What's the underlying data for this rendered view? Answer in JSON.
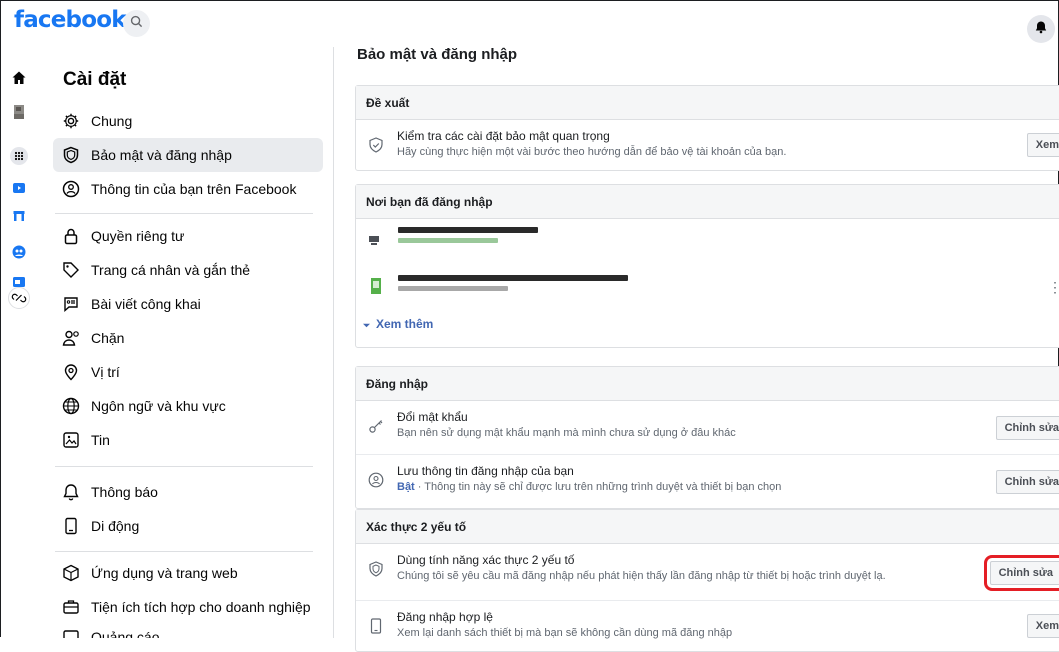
{
  "brand": {
    "logo_text": "facebook",
    "accent": "#1877f2"
  },
  "topbar": {
    "search_icon": "search-icon",
    "bell_icon": "bell-icon"
  },
  "left_rail": [
    "home-icon",
    "avatar",
    "apps-grid-icon",
    "watch-icon",
    "marketplace-icon",
    "groups-icon",
    "gaming-icon",
    "link-icon"
  ],
  "sidebar": {
    "title": "Cài đặt",
    "items": [
      {
        "label": "Chung",
        "icon": "gear-icon"
      },
      {
        "label": "Bảo mật và đăng nhập",
        "icon": "shield-icon",
        "active": true
      },
      {
        "label": "Thông tin của bạn trên Facebook",
        "icon": "info-user-icon"
      },
      {
        "label": "Quyền riêng tư",
        "icon": "lock-icon"
      },
      {
        "label": "Trang cá nhân và gắn thẻ",
        "icon": "tag-icon"
      },
      {
        "label": "Bài viết công khai",
        "icon": "post-icon"
      },
      {
        "label": "Chặn",
        "icon": "block-user-icon"
      },
      {
        "label": "Vị trí",
        "icon": "location-icon"
      },
      {
        "label": "Ngôn ngữ và khu vực",
        "icon": "globe-icon"
      },
      {
        "label": "Tin",
        "icon": "story-icon"
      },
      {
        "label": "Thông báo",
        "icon": "bell-icon"
      },
      {
        "label": "Di động",
        "icon": "mobile-icon"
      },
      {
        "label": "Ứng dụng và trang web",
        "icon": "apps-icon"
      },
      {
        "label": "Tiện ích tích hợp cho doanh nghiệp",
        "icon": "business-icon"
      },
      {
        "label": "Quảng cáo",
        "icon": "ads-icon"
      }
    ]
  },
  "main": {
    "title": "Bảo mật và đăng nhập",
    "recommended": {
      "header": "Đề xuất",
      "row": {
        "title": "Kiểm tra các cài đặt bảo mật quan trọng",
        "subtitle": "Hãy cùng thực hiện một vài bước theo hướng dẫn để bảo vệ tài khoản của bạn.",
        "button": "Xem"
      }
    },
    "where_logged_in": {
      "header": "Nơi bạn đã đăng nhập",
      "more_link": "Xem thêm",
      "menu_glyph": "⋮"
    },
    "login": {
      "header": "Đăng nhập",
      "rows": [
        {
          "title": "Đổi mật khẩu",
          "subtitle": "Bạn nên sử dụng mật khẩu mạnh mà mình chưa sử dụng ở đâu khác",
          "button": "Chỉnh sửa",
          "icon": "key-icon"
        },
        {
          "title": "Lưu thông tin đăng nhập của bạn",
          "status": "Bật",
          "subtitle": " · Thông tin này sẽ chỉ được lưu trên những trình duyệt và thiết bị bạn chọn",
          "button": "Chỉnh sửa",
          "icon": "user-circle-icon"
        }
      ]
    },
    "two_factor": {
      "header": "Xác thực 2 yếu tố",
      "rows": [
        {
          "title": "Dùng tính năng xác thực 2 yếu tố",
          "subtitle": "Chúng tôi sẽ yêu cầu mã đăng nhập nếu phát hiện thấy lần đăng nhập từ thiết bị hoặc trình duyệt lạ.",
          "button": "Chỉnh sửa",
          "icon": "shield-icon",
          "highlighted": true
        },
        {
          "title": "Đăng nhập hợp lệ",
          "subtitle": "Xem lại danh sách thiết bị mà bạn sẽ không cần dùng mã đăng nhập",
          "button": "Xem",
          "icon": "mobile-icon"
        }
      ]
    }
  },
  "highlight_color": "#e41e25"
}
